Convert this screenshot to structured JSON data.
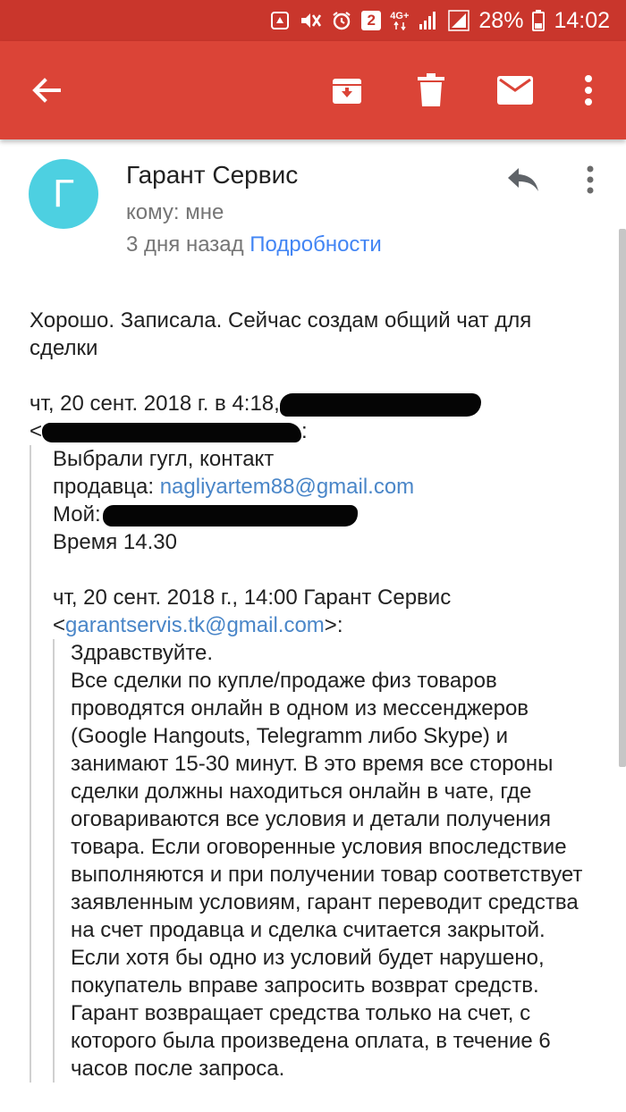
{
  "status_bar": {
    "network_type": "4G+",
    "sim_badge": "2",
    "battery": "28%",
    "time": "14:02"
  },
  "toolbar": {
    "back_icon": "arrow-back-icon",
    "archive_icon": "archive-icon",
    "delete_icon": "trash-icon",
    "mark_unread_icon": "envelope-icon",
    "more_icon": "more-vert-icon"
  },
  "message": {
    "avatar_letter": "Г",
    "avatar_color": "#4dd0e1",
    "sender": "Гарант Сервис",
    "to_line": "кому: мне",
    "date_line": "3 дня назад",
    "details_link": "Подробности",
    "reply": "Хорошо. Записала. Сейчас создам общий чат для сделки",
    "quote1": {
      "header": "чт, 20 сент. 2018 г. в 4:18,",
      "lines": [
        "Выбрали гугл, контакт",
        "продавца: ",
        "Мой:",
        "Время 14.30"
      ],
      "seller_email": "nagliyartem88@gmail.com"
    },
    "quote2": {
      "header": "чт, 20 сент. 2018 г., 14:00 Гарант Сервис",
      "email_open": "<",
      "email": "garantservis.tk@gmail.com",
      "email_close": ">:",
      "greeting": "Здравствуйте.",
      "text": "Все сделки по купле/продаже физ товаров проводятся онлайн в одном из мессенджеров (Google Hangouts, Telegramm либо Skype) и занимают 15-30 минут. В это время все стороны сделки должны находиться онлайн в чате, где оговариваются все условия и детали получения товара. Если оговоренные условия впоследствие выполняются и при получении товар соответствует заявленным условиям, гарант переводит средства на счет продавца и сделка считается закрытой. Если хотя бы одно из условий будет нарушено, покупатель вправе запросить возврат средств. Гарант возвращает средства только на счет, с которого была произведена оплата, в течение 6 часов после запроса."
    }
  },
  "colors": {
    "status_bar": "#c9362c",
    "app_bar": "#db4437",
    "link": "#4285f4"
  }
}
